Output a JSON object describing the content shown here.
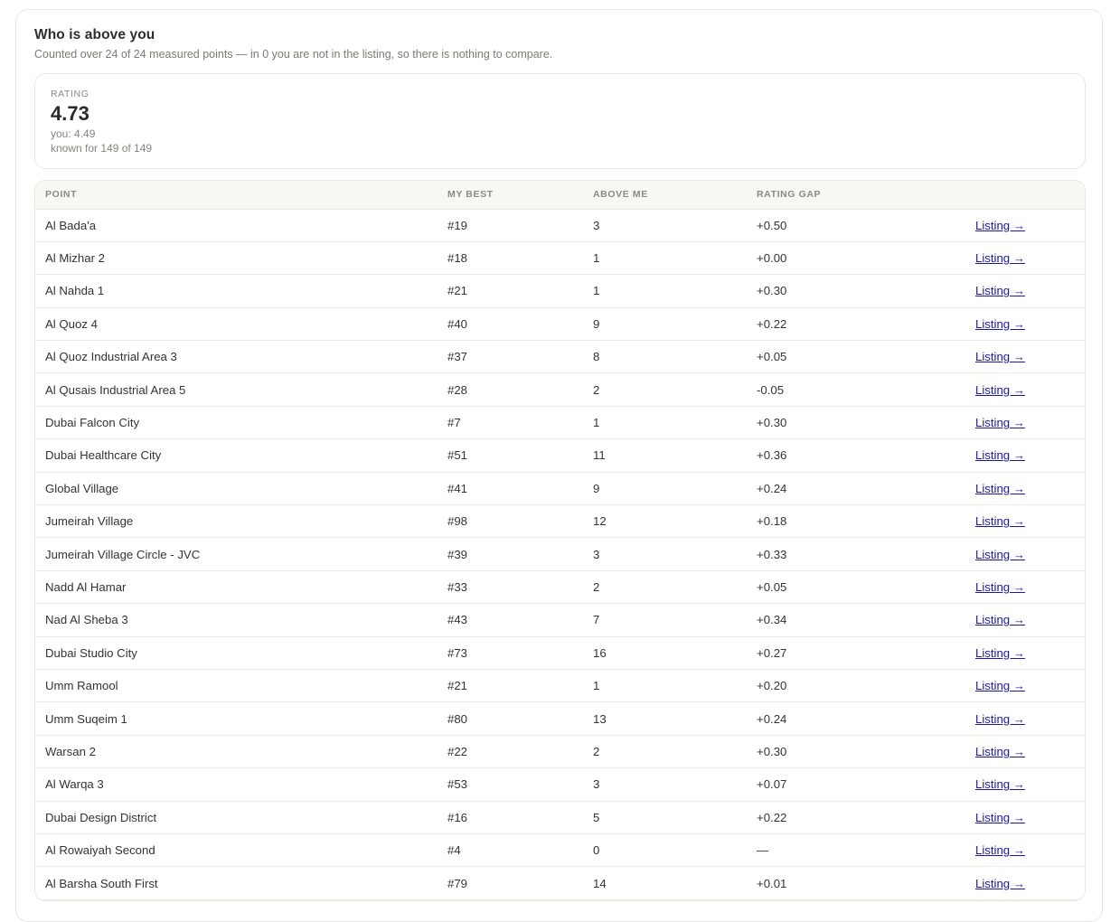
{
  "section": {
    "title": "Who is above you",
    "subtitle": "Counted over 24 of 24 measured points — in 0 you are not in the listing, so there is nothing to compare."
  },
  "rating": {
    "label": "RATING",
    "value": "4.73",
    "you": "you: 4.49",
    "known": "known for 149 of 149"
  },
  "table": {
    "headers": [
      "POINT",
      "MY BEST",
      "ABOVE ME",
      "RATING GAP",
      ""
    ],
    "link_label": "Listing →",
    "rows": [
      {
        "point": "Al Bada'a",
        "best": "#19",
        "above": "3",
        "gap": "+0.50"
      },
      {
        "point": "Al Mizhar 2",
        "best": "#18",
        "above": "1",
        "gap": "+0.00"
      },
      {
        "point": "Al Nahda 1",
        "best": "#21",
        "above": "1",
        "gap": "+0.30"
      },
      {
        "point": "Al Quoz 4",
        "best": "#40",
        "above": "9",
        "gap": "+0.22"
      },
      {
        "point": "Al Quoz Industrial Area 3",
        "best": "#37",
        "above": "8",
        "gap": "+0.05"
      },
      {
        "point": "Al Qusais Industrial Area 5",
        "best": "#28",
        "above": "2",
        "gap": "-0.05"
      },
      {
        "point": "Dubai Falcon City",
        "best": "#7",
        "above": "1",
        "gap": "+0.30"
      },
      {
        "point": "Dubai Healthcare City",
        "best": "#51",
        "above": "11",
        "gap": "+0.36"
      },
      {
        "point": "Global Village",
        "best": "#41",
        "above": "9",
        "gap": "+0.24"
      },
      {
        "point": "Jumeirah Village",
        "best": "#98",
        "above": "12",
        "gap": "+0.18"
      },
      {
        "point": "Jumeirah Village Circle - JVC",
        "best": "#39",
        "above": "3",
        "gap": "+0.33"
      },
      {
        "point": "Nadd Al Hamar",
        "best": "#33",
        "above": "2",
        "gap": "+0.05"
      },
      {
        "point": "Nad Al Sheba 3",
        "best": "#43",
        "above": "7",
        "gap": "+0.34"
      },
      {
        "point": "Dubai Studio City",
        "best": "#73",
        "above": "16",
        "gap": "+0.27"
      },
      {
        "point": "Umm Ramool",
        "best": "#21",
        "above": "1",
        "gap": "+0.20"
      },
      {
        "point": "Umm Suqeim 1",
        "best": "#80",
        "above": "13",
        "gap": "+0.24"
      },
      {
        "point": "Warsan 2",
        "best": "#22",
        "above": "2",
        "gap": "+0.30"
      },
      {
        "point": "Al Warqa 3",
        "best": "#53",
        "above": "3",
        "gap": "+0.07"
      },
      {
        "point": "Dubai Design District",
        "best": "#16",
        "above": "5",
        "gap": "+0.22"
      },
      {
        "point": "Al Rowaiyah Second",
        "best": "#4",
        "above": "0",
        "gap": "—"
      },
      {
        "point": "Al Barsha South First",
        "best": "#79",
        "above": "14",
        "gap": "+0.01"
      }
    ]
  }
}
